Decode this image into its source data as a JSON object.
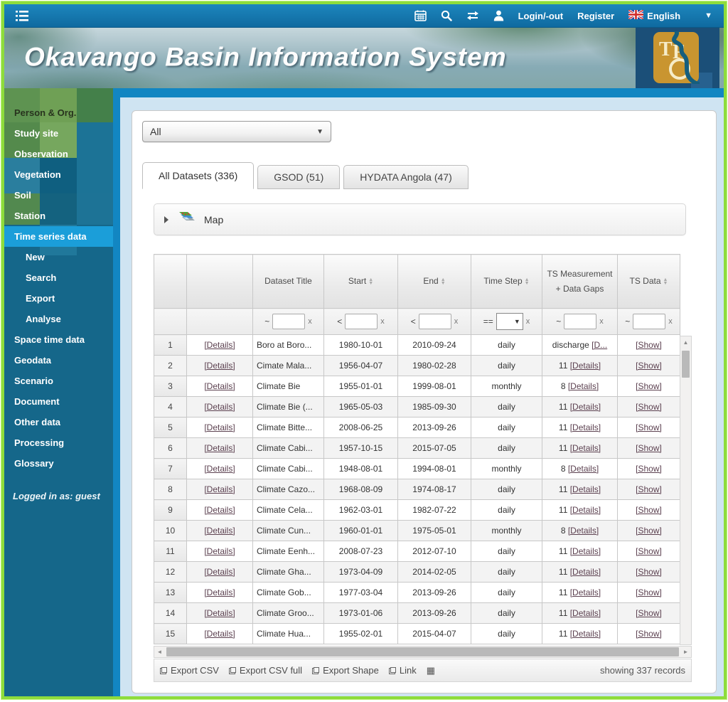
{
  "colors": {
    "topbar_blue": "#1d86bd",
    "frame_blue": "#1286c2",
    "sidebar_teal": "#15678a",
    "active_item_blue": "#1b9ed9",
    "page_border_green": "#8ddc3c",
    "content_bg": "#cfe4f2",
    "link_color": "#5c4150",
    "logo_gold": "#c99530"
  },
  "topbar": {
    "login_label": "Login/-out",
    "register_label": "Register",
    "language_label": "English"
  },
  "header": {
    "title": "Okavango Basin Information System",
    "logo_letters": "TFO"
  },
  "sidebar": {
    "items": [
      {
        "label": "Person & Org.",
        "dark": true
      },
      {
        "label": "Study site"
      },
      {
        "label": "Observation"
      },
      {
        "label": "Vegetation"
      },
      {
        "label": "Soil"
      },
      {
        "label": "Station"
      },
      {
        "label": "Time series data",
        "active": true
      },
      {
        "label": "New",
        "sub": true
      },
      {
        "label": "Search",
        "sub": true
      },
      {
        "label": "Export",
        "sub": true
      },
      {
        "label": "Analyse",
        "sub": true
      },
      {
        "label": "Space time data"
      },
      {
        "label": "Geodata"
      },
      {
        "label": "Scenario"
      },
      {
        "label": "Document"
      },
      {
        "label": "Other data"
      },
      {
        "label": "Processing"
      },
      {
        "label": "Glossary"
      }
    ],
    "logged_in_text": "Logged in as: guest"
  },
  "main": {
    "dataset_select": {
      "value": "All"
    },
    "tabs": [
      {
        "label": "All Datasets (336)",
        "active": true
      },
      {
        "label": "GSOD (51)",
        "active": false
      },
      {
        "label": "HYDATA Angola (47)",
        "active": false
      }
    ],
    "map_panel": {
      "label": "Map"
    },
    "table": {
      "columns": [
        "",
        "",
        "Dataset Title",
        "Start",
        "End",
        "Time Step",
        "TS Measurement + Data Gaps",
        "TS Data"
      ],
      "filters": {
        "title_op": "~",
        "start_op": "<",
        "end_op": "<",
        "step_op": "==",
        "meas_op": "~",
        "data_op": "~",
        "clear_label": "x"
      },
      "rows": [
        {
          "num": "1",
          "details": "[Details]",
          "title": "Boro at Boro...",
          "start": "1980-10-01",
          "end": "2010-09-24",
          "step": "daily",
          "meas_prefix": "discharge",
          "meas_link": "[D...",
          "show": "[Show]"
        },
        {
          "num": "2",
          "details": "[Details]",
          "title": "Cimate Mala...",
          "start": "1956-04-07",
          "end": "1980-02-28",
          "step": "daily",
          "meas_prefix": "11",
          "meas_link": "[Details]",
          "show": "[Show]"
        },
        {
          "num": "3",
          "details": "[Details]",
          "title": "Climate Bie",
          "start": "1955-01-01",
          "end": "1999-08-01",
          "step": "monthly",
          "meas_prefix": "8",
          "meas_link": "[Details]",
          "show": "[Show]"
        },
        {
          "num": "4",
          "details": "[Details]",
          "title": "Climate Bie (...",
          "start": "1965-05-03",
          "end": "1985-09-30",
          "step": "daily",
          "meas_prefix": "11",
          "meas_link": "[Details]",
          "show": "[Show]"
        },
        {
          "num": "5",
          "details": "[Details]",
          "title": "Climate Bitte...",
          "start": "2008-06-25",
          "end": "2013-09-26",
          "step": "daily",
          "meas_prefix": "11",
          "meas_link": "[Details]",
          "show": "[Show]"
        },
        {
          "num": "6",
          "details": "[Details]",
          "title": "Climate Cabi...",
          "start": "1957-10-15",
          "end": "2015-07-05",
          "step": "daily",
          "meas_prefix": "11",
          "meas_link": "[Details]",
          "show": "[Show]"
        },
        {
          "num": "7",
          "details": "[Details]",
          "title": "Climate Cabi...",
          "start": "1948-08-01",
          "end": "1994-08-01",
          "step": "monthly",
          "meas_prefix": "8",
          "meas_link": "[Details]",
          "show": "[Show]"
        },
        {
          "num": "8",
          "details": "[Details]",
          "title": "Climate Cazo...",
          "start": "1968-08-09",
          "end": "1974-08-17",
          "step": "daily",
          "meas_prefix": "11",
          "meas_link": "[Details]",
          "show": "[Show]"
        },
        {
          "num": "9",
          "details": "[Details]",
          "title": "Climate Cela...",
          "start": "1962-03-01",
          "end": "1982-07-22",
          "step": "daily",
          "meas_prefix": "11",
          "meas_link": "[Details]",
          "show": "[Show]"
        },
        {
          "num": "10",
          "details": "[Details]",
          "title": "Climate Cun...",
          "start": "1960-01-01",
          "end": "1975-05-01",
          "step": "monthly",
          "meas_prefix": "8",
          "meas_link": "[Details]",
          "show": "[Show]"
        },
        {
          "num": "11",
          "details": "[Details]",
          "title": "Climate Eenh...",
          "start": "2008-07-23",
          "end": "2012-07-10",
          "step": "daily",
          "meas_prefix": "11",
          "meas_link": "[Details]",
          "show": "[Show]"
        },
        {
          "num": "12",
          "details": "[Details]",
          "title": "Climate Gha...",
          "start": "1973-04-09",
          "end": "2014-02-05",
          "step": "daily",
          "meas_prefix": "11",
          "meas_link": "[Details]",
          "show": "[Show]"
        },
        {
          "num": "13",
          "details": "[Details]",
          "title": "Climate Gob...",
          "start": "1977-03-04",
          "end": "2013-09-26",
          "step": "daily",
          "meas_prefix": "11",
          "meas_link": "[Details]",
          "show": "[Show]"
        },
        {
          "num": "14",
          "details": "[Details]",
          "title": "Climate Groo...",
          "start": "1973-01-06",
          "end": "2013-09-26",
          "step": "daily",
          "meas_prefix": "11",
          "meas_link": "[Details]",
          "show": "[Show]"
        },
        {
          "num": "15",
          "details": "[Details]",
          "title": "Climate Hua...",
          "start": "1955-02-01",
          "end": "2015-04-07",
          "step": "daily",
          "meas_prefix": "11",
          "meas_link": "[Details]",
          "show": "[Show]"
        }
      ],
      "footer": {
        "export_links": [
          "Export CSV",
          "Export CSV full",
          "Export Shape",
          "Link"
        ],
        "records_text": "showing 337 records"
      }
    }
  }
}
